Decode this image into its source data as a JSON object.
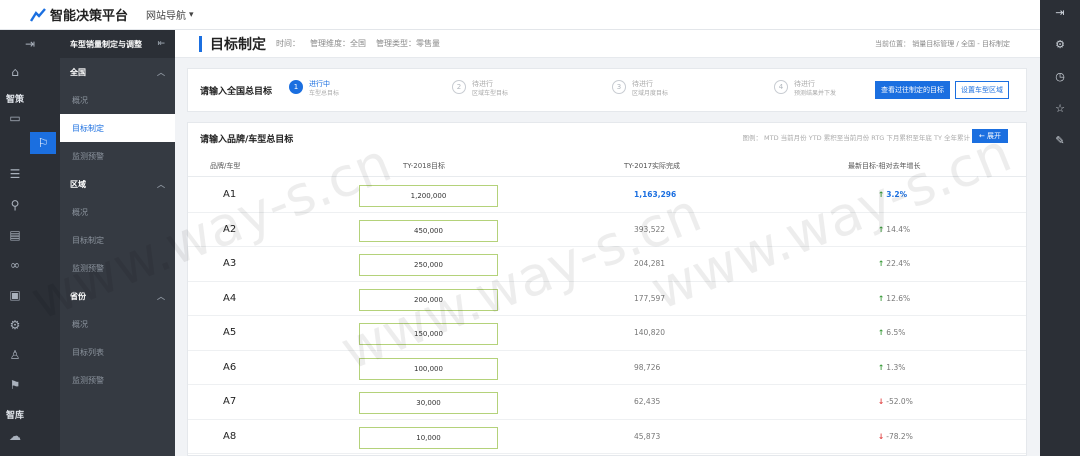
{
  "header": {
    "app_title": "智能决策平台",
    "site_nav": "网站导航"
  },
  "icon_bar": {
    "labels": {
      "zhice": "智策",
      "zhiku": "智库"
    }
  },
  "submenu": {
    "top_title": "车型销量制定与调整",
    "groups": [
      {
        "title": "全国",
        "items": [
          "概况",
          "目标制定",
          "监测预警"
        ]
      },
      {
        "title": "区域",
        "items": [
          "概况",
          "目标制定",
          "监测预警"
        ]
      },
      {
        "title": "省份",
        "items": [
          "概况",
          "目标列表",
          "监测预警"
        ]
      }
    ]
  },
  "page": {
    "title": "目标制定",
    "time_label": "时间：",
    "dimension": "管理维度：全国",
    "type": "管理类型：零售量",
    "breadcrumb": "当前位置： 销量目标管理 / 全国 - 目标制定"
  },
  "steps": {
    "label": "请输入全国总目标",
    "items": [
      {
        "num": "1",
        "status": "进行中",
        "desc": "车型总目标"
      },
      {
        "num": "2",
        "status": "待进行",
        "desc": "区域车型目标"
      },
      {
        "num": "3",
        "status": "待进行",
        "desc": "区域月度目标"
      },
      {
        "num": "4",
        "status": "待进行",
        "desc": "预测结果并下发"
      }
    ],
    "btn_view": "查看过往制定的目标",
    "btn_set": "设置车型区域"
  },
  "table": {
    "label": "请输入品牌/车型总目标",
    "filters": "图例： MTD 当前月份    YTD 累积至当前月份    RTG 下月累积至年底    TY 全年累计",
    "expand": "展开",
    "columns": [
      "品牌/车型",
      "TY-2018目标",
      "TY-2017实际完成",
      "最新目标-相对去年增长"
    ],
    "rows": [
      {
        "name": "A1",
        "target": "1,200,000",
        "prev": "1,163,296",
        "growth": "3.2%",
        "dir": "up"
      },
      {
        "name": "A2",
        "target": "450,000",
        "prev": "393,522",
        "growth": "14.4%",
        "dir": "up"
      },
      {
        "name": "A3",
        "target": "250,000",
        "prev": "204,281",
        "growth": "22.4%",
        "dir": "up"
      },
      {
        "name": "A4",
        "target": "200,000",
        "prev": "177,597",
        "growth": "12.6%",
        "dir": "up"
      },
      {
        "name": "A5",
        "target": "150,000",
        "prev": "140,820",
        "growth": "6.5%",
        "dir": "up"
      },
      {
        "name": "A6",
        "target": "100,000",
        "prev": "98,726",
        "growth": "1.3%",
        "dir": "up"
      },
      {
        "name": "A7",
        "target": "30,000",
        "prev": "62,435",
        "growth": "-52.0%",
        "dir": "down"
      },
      {
        "name": "A8",
        "target": "10,000",
        "prev": "45,873",
        "growth": "-78.2%",
        "dir": "down"
      }
    ]
  },
  "watermark": "www.way-s.cn",
  "colors": {
    "accent": "#1b6fe0",
    "sidebar": "#2b2f36",
    "up": "#3a9b3a",
    "down": "#e04545"
  }
}
